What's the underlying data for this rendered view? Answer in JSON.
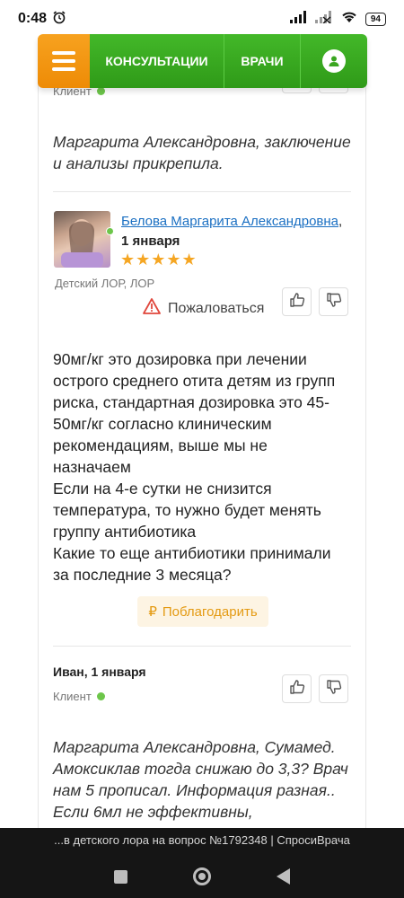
{
  "status_bar": {
    "time": "0:48",
    "battery": "94"
  },
  "nav": {
    "consultations_label": "КОНСУЛЬТАЦИИ",
    "doctors_label": "ВРАЧИ"
  },
  "post_top": {
    "role": "Клиент",
    "text": "Маргарита Александровна, заключение и анализы прикрепила."
  },
  "doctor_answer": {
    "name": "Белова Маргарита Александровна",
    "date": "1 января",
    "rating_stars": "★★★★★",
    "rating": 5,
    "specialty": "Детский ЛОР, ЛОР",
    "report_label": "Пожаловаться",
    "paragraph1": "90мг/кг это дозировка при лечении острого среднего отита детям из групп риска, стандартная дозировка это 45-50мг/кг согласно клиническим рекомендациям, выше мы не назначаем",
    "paragraph2a": "Если на 4-е сутки не снизится температура, то нужно будет менять группу антибиотика",
    "paragraph2b": "Какие то еще антибиотики принимали за последние 3 месяца?",
    "thank_label": "Поблагодарить",
    "thank_icon": "₽"
  },
  "client_reply": {
    "author_date": "Иван, 1 января",
    "role": "Клиент",
    "text": "Маргарита Александровна, Сумамед. Амоксиклав тогда снижаю до 3,3? Врач нам 5 прописал. Информация разная.. Если 6мл не эффективны,"
  },
  "footer": {
    "text": "...в детского лора на вопрос №1792348 | СпросиВрача"
  },
  "colors": {
    "nav_green": "#3aa620",
    "nav_orange": "#f39a14",
    "link_blue": "#1a6fc2",
    "star_gold": "#f5a623"
  }
}
